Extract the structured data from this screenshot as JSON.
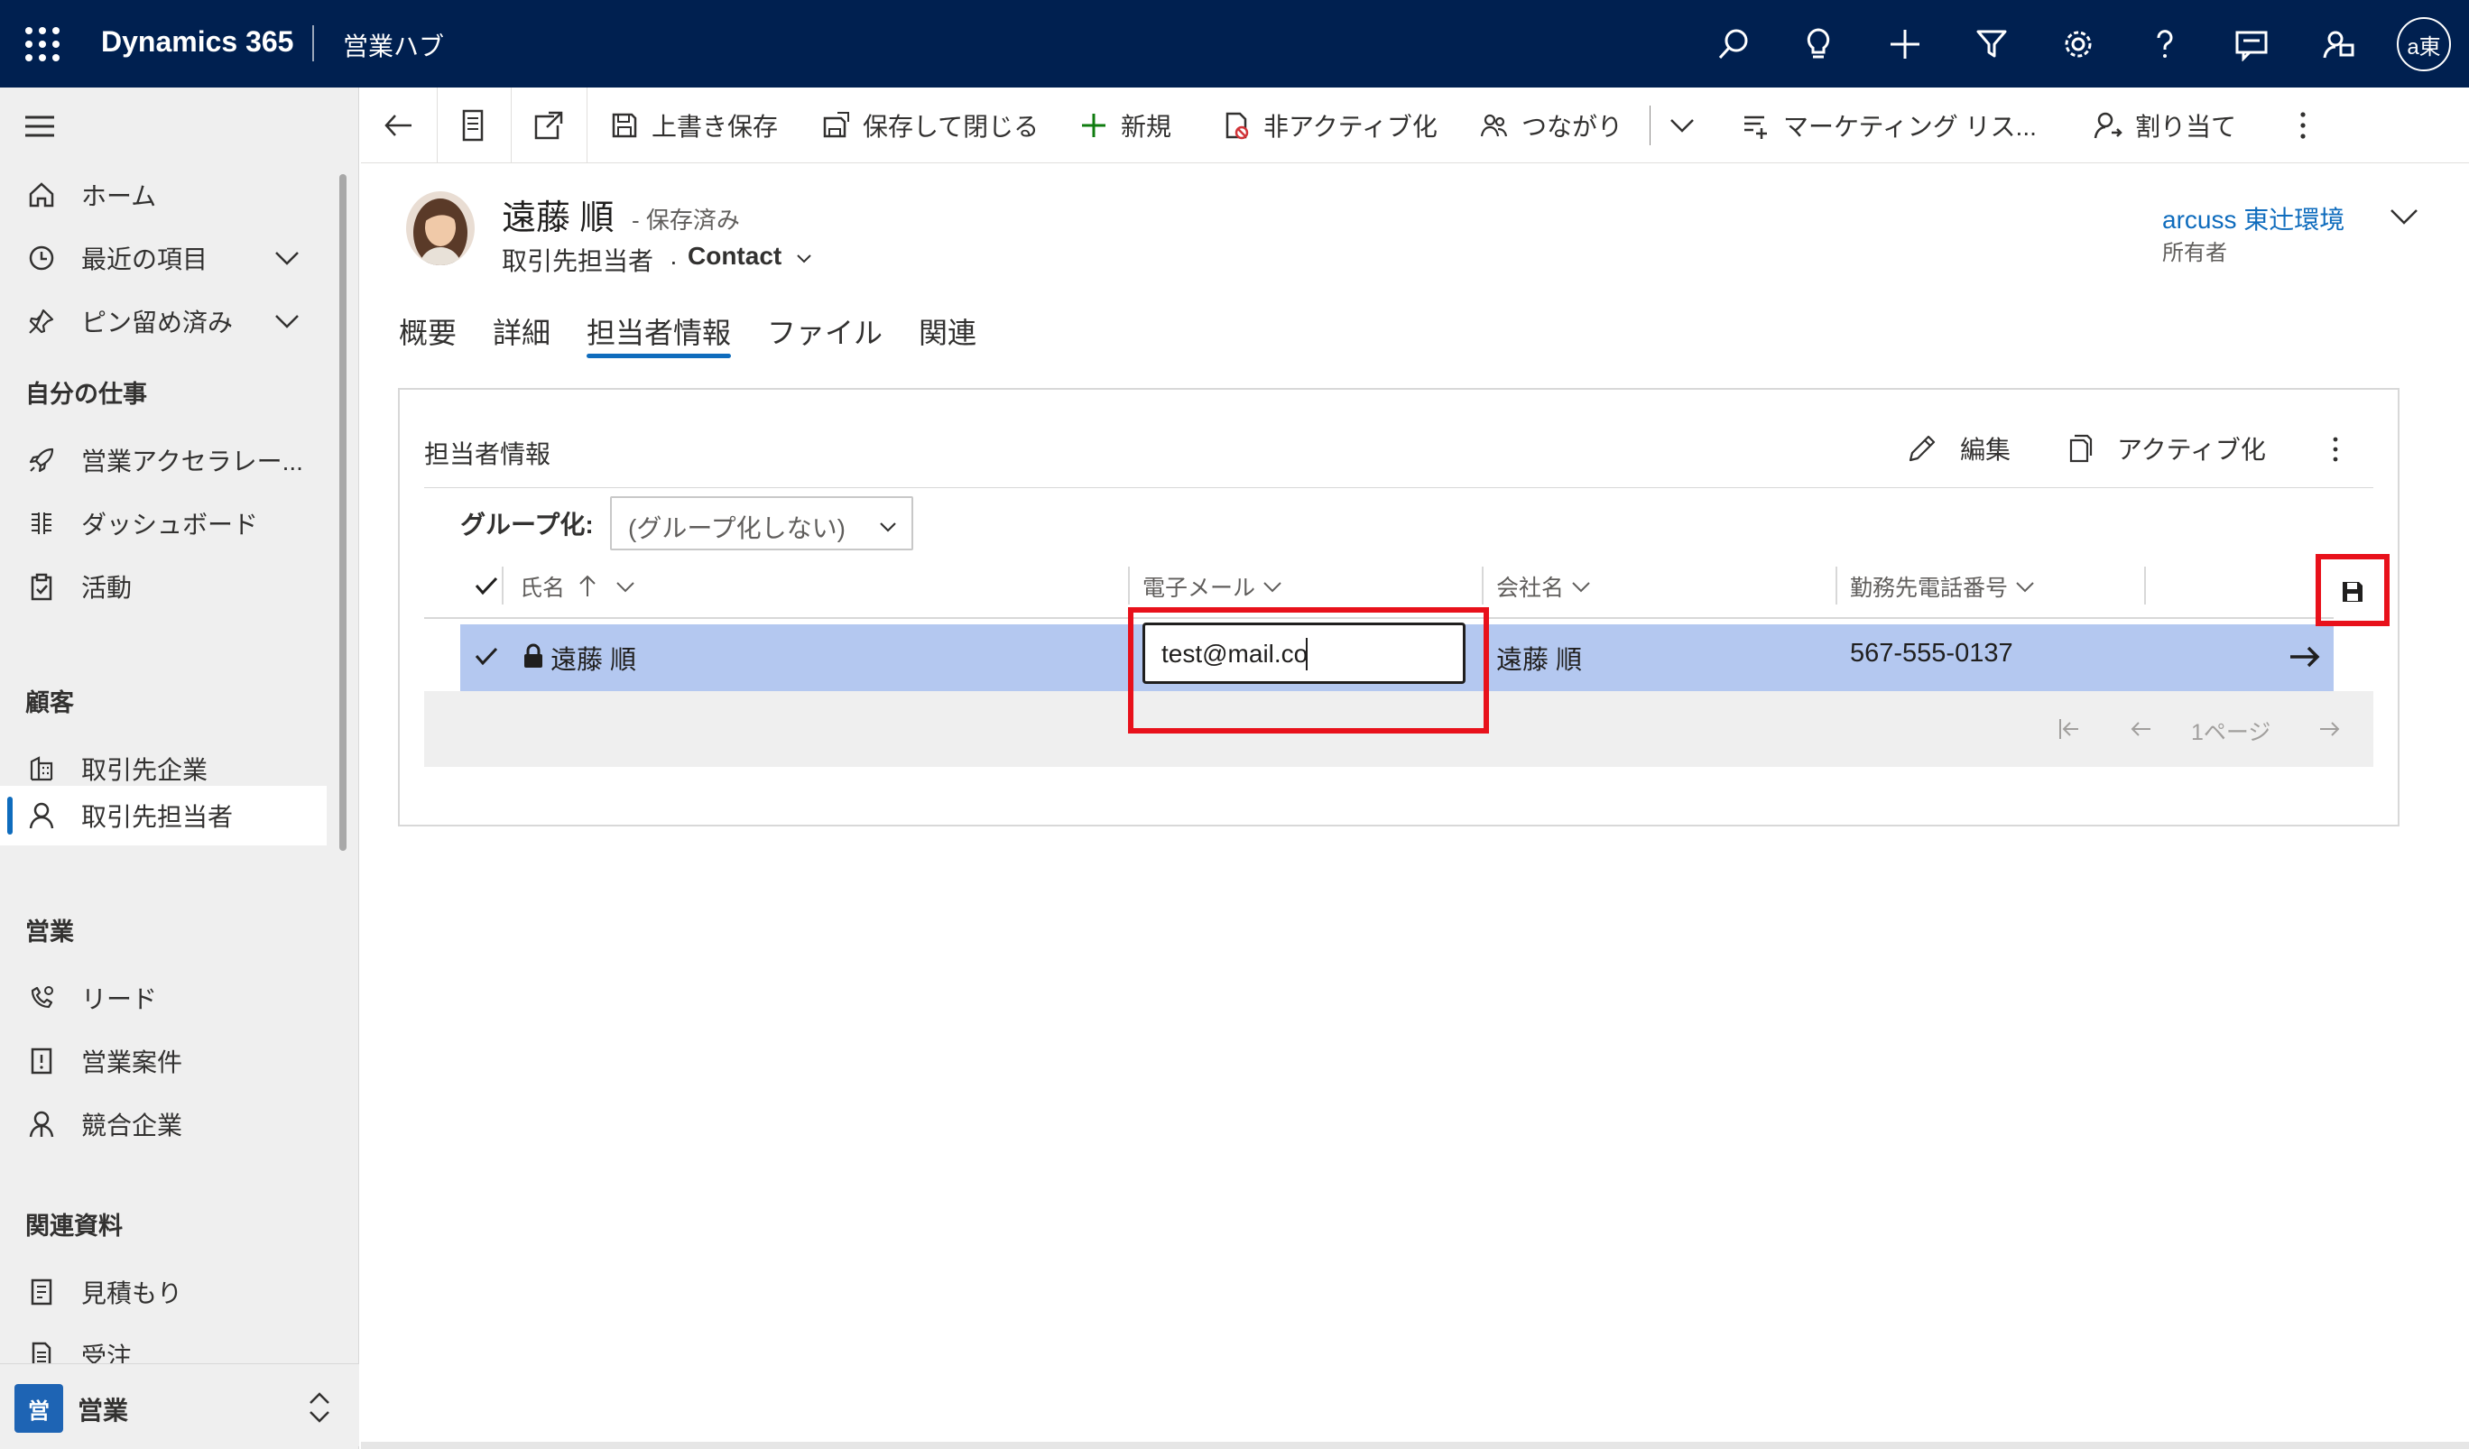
{
  "topbar": {
    "app_name": "Dynamics 365",
    "hub_name": "営業ハブ",
    "user_initials": "a東",
    "icons": [
      "search-icon",
      "lightbulb-icon",
      "add-icon",
      "filter-icon",
      "settings-icon",
      "help-icon",
      "chat-icon",
      "feedback-icon"
    ]
  },
  "sidebar": {
    "top_items": [
      {
        "label": "ホーム",
        "icon": "home-icon"
      },
      {
        "label": "最近の項目",
        "icon": "clock-icon"
      },
      {
        "label": "ピン留め済み",
        "icon": "pin-icon"
      }
    ],
    "group_my_work": "自分の仕事",
    "my_work_items": [
      {
        "label": "営業アクセラレー...",
        "icon": "rocket-icon"
      },
      {
        "label": "ダッシュボード",
        "icon": "dashboard-icon"
      },
      {
        "label": "活動",
        "icon": "clipboard-icon"
      }
    ],
    "group_customers": "顧客",
    "customer_items": [
      {
        "label": "取引先企業",
        "icon": "account-icon"
      },
      {
        "label": "取引先担当者",
        "icon": "person-icon"
      }
    ],
    "group_sales": "営業",
    "sales_items": [
      {
        "label": "リード",
        "icon": "lead-phone-icon"
      },
      {
        "label": "営業案件",
        "icon": "opportunity-icon"
      },
      {
        "label": "競合企業",
        "icon": "competitor-icon"
      }
    ],
    "group_collateral": "関連資料",
    "collateral_items": [
      {
        "label": "見積もり",
        "icon": "quote-icon"
      },
      {
        "label": "受注",
        "icon": "order-icon"
      }
    ],
    "area": {
      "badge": "営",
      "label": "営業"
    }
  },
  "commandbar": {
    "save": "上書き保存",
    "save_close": "保存して閉じる",
    "new": "新規",
    "deactivate": "非アクティブ化",
    "connect": "つながり",
    "marketing_list": "マーケティング リス...",
    "assign": "割り当て"
  },
  "record": {
    "name": "遠藤 順",
    "saved_status": "- 保存済み",
    "entity": "取引先担当者",
    "dot": "·",
    "form": "Contact",
    "owner_name": "arcuss 東辻環境",
    "owner_label": "所有者"
  },
  "tabs": [
    {
      "label": "概要"
    },
    {
      "label": "詳細"
    },
    {
      "label": "担当者情報",
      "active": true
    },
    {
      "label": "ファイル"
    },
    {
      "label": "関連"
    }
  ],
  "subgrid": {
    "title": "担当者情報",
    "edit": "編集",
    "activate": "アクティブ化",
    "group_by_label": "グループ化:",
    "group_by_value": "(グループ化しない)",
    "columns": {
      "name": "氏名",
      "email": "電子メール",
      "company": "会社名",
      "phone": "勤務先電話番号"
    },
    "row": {
      "name": "遠藤 順",
      "email": "test@mail.co",
      "company": "遠藤 順",
      "phone": "567-555-0137"
    },
    "page_label": "1ページ"
  },
  "colors": {
    "topbar": "#002050",
    "accent": "#0f6cbd",
    "selected_row": "#b4c8f0",
    "highlight": "#e8111b"
  }
}
